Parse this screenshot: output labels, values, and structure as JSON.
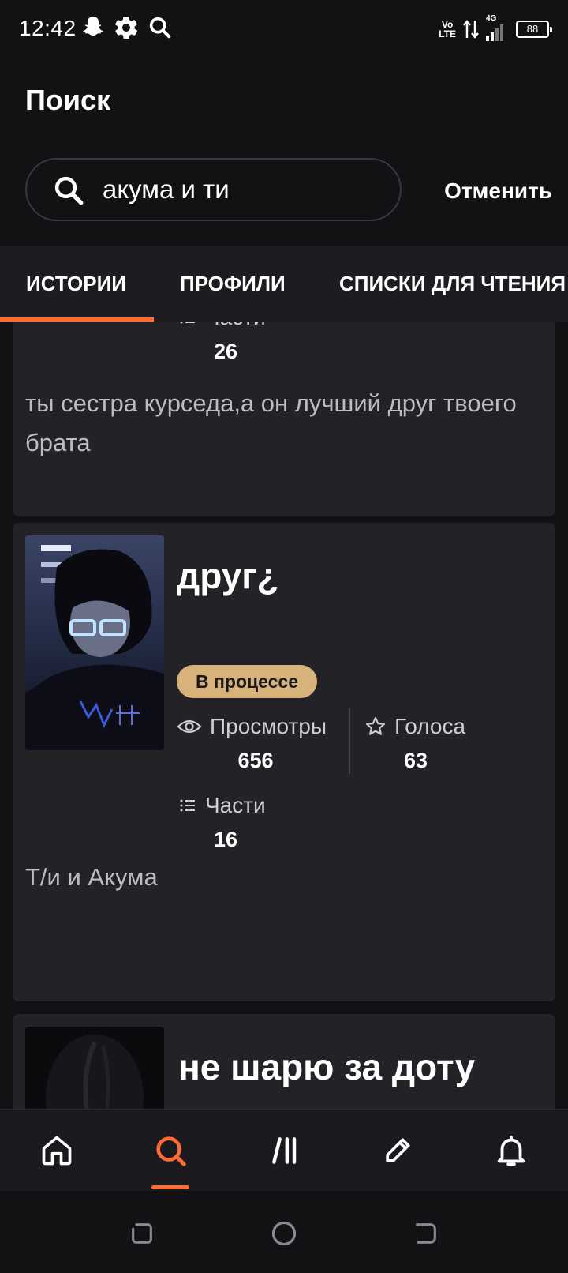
{
  "status_bar": {
    "time": "12:42",
    "icons": [
      "snapchat-icon",
      "gear-icon",
      "search-icon"
    ],
    "network_top": "Vo",
    "network_bottom": "LTE",
    "signal_type": "4G",
    "battery": "88"
  },
  "header": {
    "title": "Поиск",
    "search_value": "акума и ти",
    "cancel_label": "Отменить"
  },
  "tabs": [
    {
      "label": "ИСТОРИИ",
      "active": true
    },
    {
      "label": "ПРОФИЛИ",
      "active": false
    },
    {
      "label": "СПИСКИ ДЛЯ ЧТЕНИЯ",
      "active": false
    }
  ],
  "accent_color": "#ff6b35",
  "stories": [
    {
      "parts_label": "Части",
      "parts_value": "26",
      "description": "ты сестра курседа,а он лучший друг твоего брата"
    },
    {
      "title": "друг¿",
      "status": "В процессе",
      "views_label": "Просмотры",
      "views_value": "656",
      "votes_label": "Голоса",
      "votes_value": "63",
      "parts_label": "Части",
      "parts_value": "16",
      "description": "Т/и и Акума"
    },
    {
      "title": "не шарю за доту"
    }
  ],
  "bottom_nav": {
    "items": [
      "home-icon",
      "search-icon",
      "library-icon",
      "write-icon",
      "bell-icon"
    ],
    "active": "search-icon"
  },
  "system_nav": [
    "recent-apps-icon",
    "home-circle-icon",
    "back-icon"
  ]
}
